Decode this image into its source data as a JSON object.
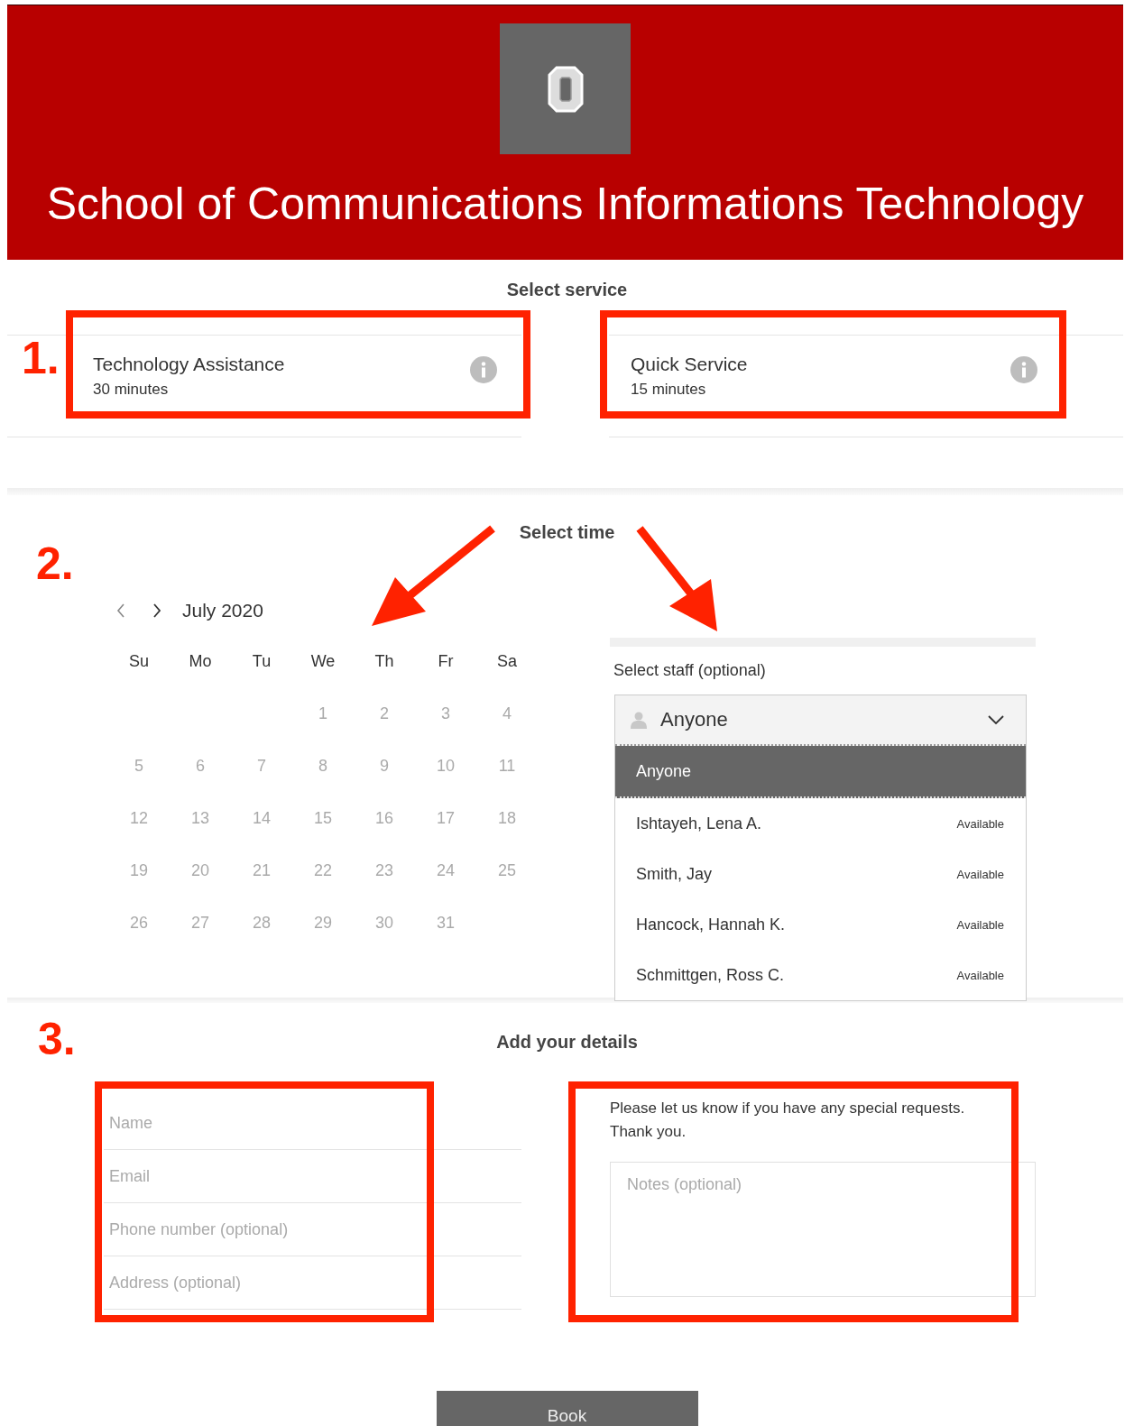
{
  "header": {
    "title": "School of Communications Informations Technology"
  },
  "annotations": {
    "steps": [
      "1.",
      "2.",
      "3."
    ]
  },
  "service_section": {
    "heading": "Select service",
    "services": [
      {
        "name": "Technology Assistance",
        "duration": "30 minutes"
      },
      {
        "name": "Quick Service",
        "duration": "15 minutes"
      }
    ]
  },
  "time_section": {
    "heading": "Select time",
    "calendar": {
      "month": "July 2020",
      "weekdays": [
        "Su",
        "Mo",
        "Tu",
        "We",
        "Th",
        "Fr",
        "Sa"
      ],
      "weeks": [
        [
          "1",
          "2",
          "3",
          "4"
        ],
        [
          "5",
          "6",
          "7",
          "8",
          "9",
          "10",
          "11"
        ],
        [
          "12",
          "13",
          "14",
          "15",
          "16",
          "17",
          "18"
        ],
        [
          "19",
          "20",
          "21",
          "22",
          "23",
          "24",
          "25"
        ],
        [
          "26",
          "27",
          "28",
          "29",
          "30",
          "31"
        ]
      ]
    },
    "staff": {
      "label": "Select staff (optional)",
      "value": "Anyone",
      "expanded": true,
      "options": [
        {
          "name": "Anyone",
          "selected": true
        },
        {
          "name": "Ishtayeh, Lena A.",
          "status": "Available",
          "selected": false
        },
        {
          "name": "Smith, Jay",
          "status": "Available",
          "selected": false
        },
        {
          "name": "Hancock, Hannah K.",
          "status": "Available",
          "selected": false
        },
        {
          "name": "Schmittgen, Ross C.",
          "status": "Available",
          "selected": false
        }
      ]
    }
  },
  "details_section": {
    "heading": "Add your details",
    "fields": [
      {
        "placeholder": "Name"
      },
      {
        "placeholder": "Email"
      },
      {
        "placeholder": "Phone number (optional)"
      },
      {
        "placeholder": "Address (optional)"
      }
    ],
    "note_text": "Please let us know if you have any special requests. Thank you.",
    "notes": {
      "placeholder": "Notes (optional)"
    }
  },
  "book_button": "Book"
}
